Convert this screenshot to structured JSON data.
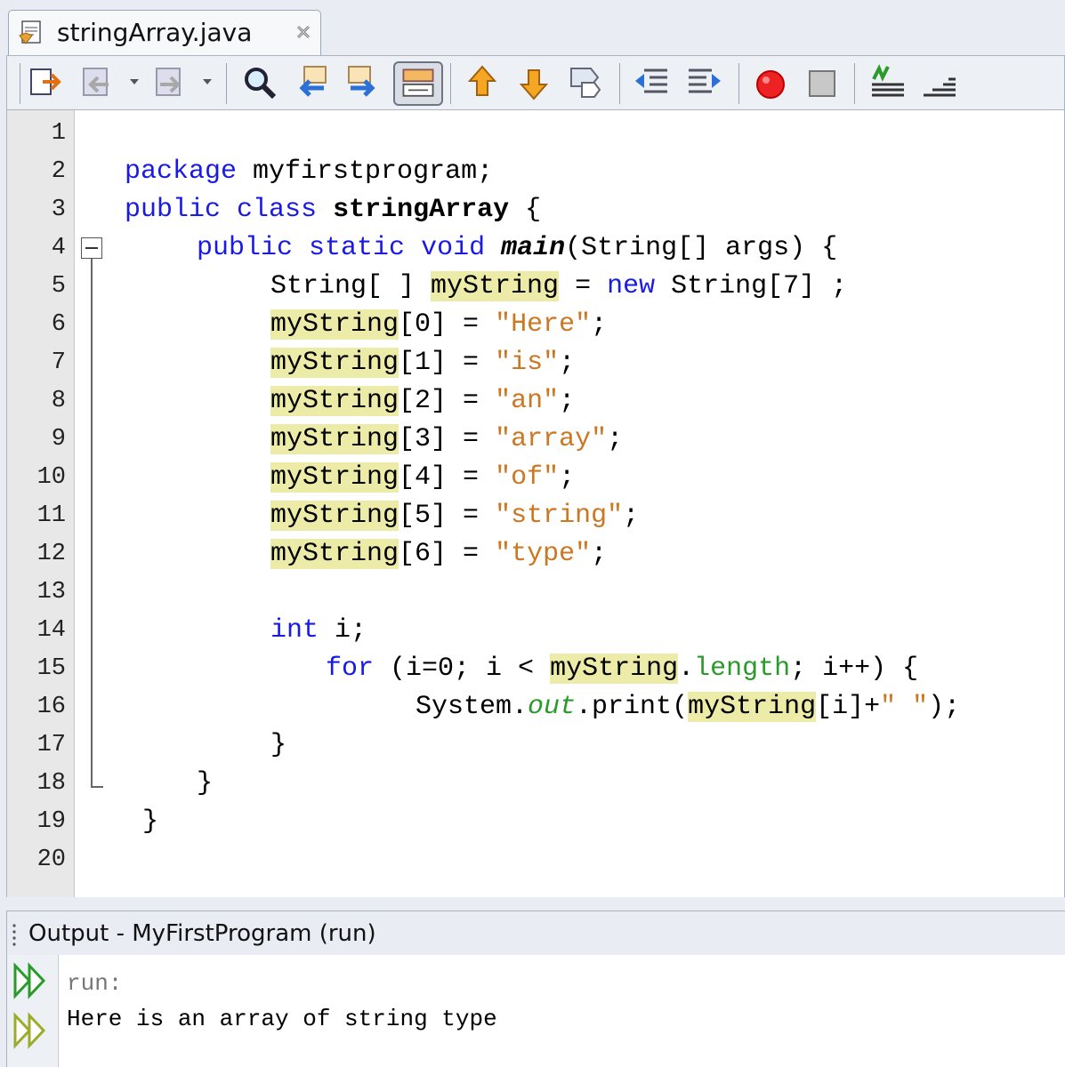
{
  "tab": {
    "title": "stringArray.java"
  },
  "editor": {
    "line_numbers": [
      "1",
      "2",
      "3",
      "4",
      "5",
      "6",
      "7",
      "8",
      "9",
      "10",
      "11",
      "12",
      "13",
      "14",
      "15",
      "16",
      "17",
      "18",
      "19",
      "20"
    ],
    "tokens": {
      "l2_kw": "package",
      "l2_rest": " myfirstprogram;",
      "l3_kw1": "public",
      "l3_kw2": "class",
      "l3_name": "stringArray",
      "l3_brace": " {",
      "l4_kw1": "public",
      "l4_kw2": "static",
      "l4_kw3": "void",
      "l4_main": "main",
      "l4_rest": "(String[] args) {",
      "l5_a": "String[ ] ",
      "l5_var": "myString",
      "l5_b": " = ",
      "l5_new": "new",
      "l5_c": " String[7] ;",
      "var": "myString",
      "l6_idx": "[0] = ",
      "l6_str": "\"Here\"",
      "semi": ";",
      "l7_idx": "[1] = ",
      "l7_str": "\"is\"",
      "l8_idx": "[2] = ",
      "l8_str": "\"an\"",
      "l9_idx": "[3] = ",
      "l9_str": "\"array\"",
      "l10_idx": "[4] = ",
      "l10_str": "\"of\"",
      "l11_idx": "[5] = ",
      "l11_str": "\"string\"",
      "l12_idx": "[6] = ",
      "l12_str": "\"type\"",
      "l14_kw": "int",
      "l14_rest": " i;",
      "l15_kw": "for",
      "l15_a": " (i=0; i < ",
      "l15_dot": ".",
      "l15_len": "length",
      "l15_b": "; i++) {",
      "l16_a": "System.",
      "l16_out": "out",
      "l16_b": ".print(",
      "l16_c": "[i]+",
      "l16_str": "\" \"",
      "l16_d": ");",
      "close_brace": "}"
    }
  },
  "output": {
    "title": "Output - MyFirstProgram (run)",
    "lines": [
      "run:",
      "Here is an array of string type"
    ]
  },
  "colors": {
    "keyword": "#1a1ae6",
    "string": "#cc7722",
    "field": "#2a9a2a",
    "highlight": "#ececa8",
    "output_run": "#777777"
  },
  "toolbar_icons": [
    "last-edit-icon",
    "back-icon",
    "forward-icon",
    "find-selection-icon",
    "find-previous-icon",
    "find-next-icon",
    "toggle-highlight-icon",
    "previous-bookmark-icon",
    "next-bookmark-icon",
    "toggle-bookmark-icon",
    "shift-left-icon",
    "shift-right-icon",
    "start-macro-icon",
    "stop-macro-icon",
    "comment-icon",
    "uncomment-icon"
  ]
}
